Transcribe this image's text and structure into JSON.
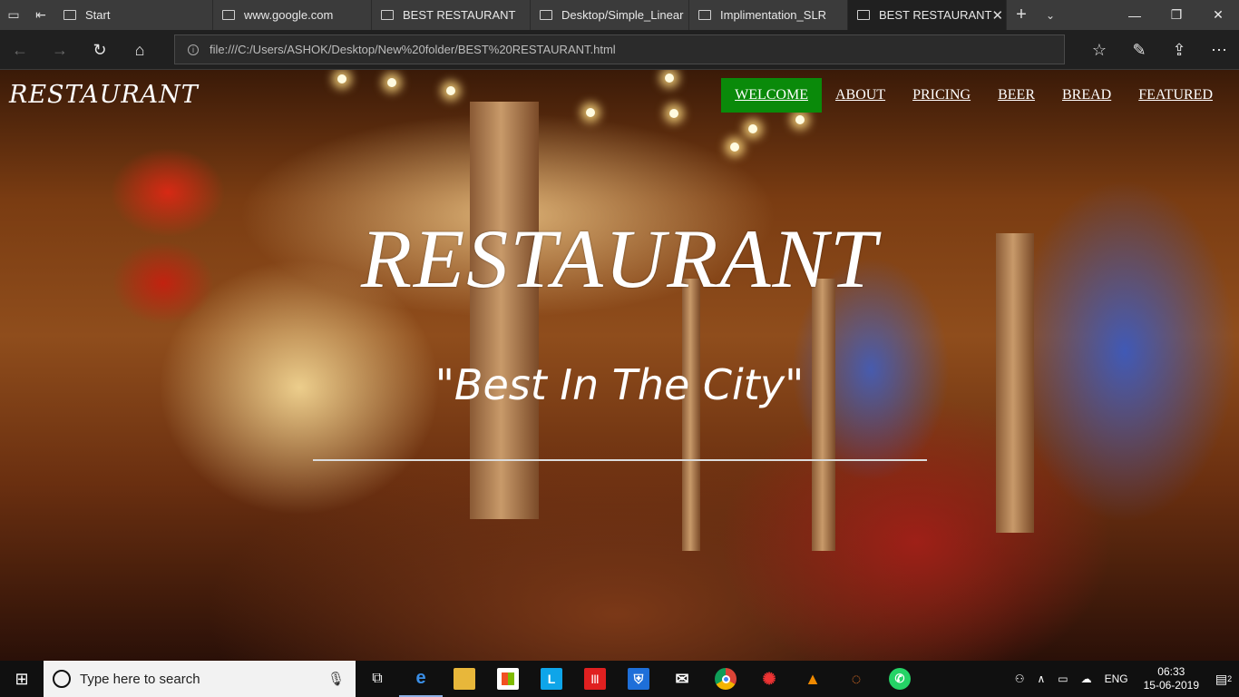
{
  "browser": {
    "tabs": [
      {
        "title": "Start",
        "active": false
      },
      {
        "title": "www.google.com",
        "active": false
      },
      {
        "title": "BEST RESTAURANT",
        "active": false
      },
      {
        "title": "Desktop/Simple_Linear",
        "active": false
      },
      {
        "title": "Implimentation_SLR",
        "active": false
      },
      {
        "title": "BEST RESTAURANT",
        "active": true
      }
    ],
    "address": "file:///C:/Users/ASHOK/Desktop/New%20folder/BEST%20RESTAURANT.html"
  },
  "site": {
    "logo": "RESTAURANT",
    "nav": [
      {
        "label": "WELCOME",
        "active": true
      },
      {
        "label": "ABOUT",
        "active": false
      },
      {
        "label": "PRICING",
        "active": false
      },
      {
        "label": "BEER",
        "active": false
      },
      {
        "label": "BREAD",
        "active": false
      },
      {
        "label": "FEATURED",
        "active": false
      }
    ],
    "hero_title": "RESTAURANT",
    "hero_subtitle": "\"Best In The City\"",
    "active_nav_color": "#0a8a0a"
  },
  "taskbar": {
    "search_placeholder": "Type here to search",
    "language": "ENG",
    "time": "06:33",
    "date": "15-06-2019",
    "notification_count": "2"
  }
}
